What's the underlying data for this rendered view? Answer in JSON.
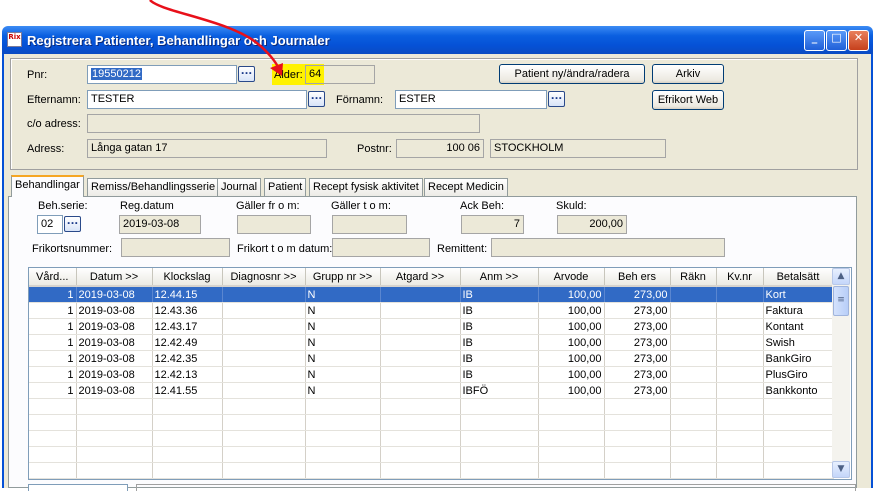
{
  "window": {
    "title": "Registrera Patienter, Behandlingar och Journaler",
    "icon_text": "Rix",
    "minimize": "_",
    "maximize": "□",
    "close": "✕"
  },
  "patient": {
    "pnr_label": "Pnr:",
    "pnr_value": "19550212",
    "alder_label": "Ålder:",
    "alder_value": "64",
    "efternamn_label": "Efternamn:",
    "efternamn_value": "TESTER",
    "fornamn_label": "Förnamn:",
    "fornamn_value": "ESTER",
    "co_label": "c/o adress:",
    "co_value": "",
    "adress_label": "Adress:",
    "adress_value": "Långa gatan 17",
    "postnr_label": "Postnr:",
    "postnr_value": "100 06",
    "ort_value": "STOCKHOLM",
    "btn_patient": "Patient ny/ändra/radera",
    "btn_arkiv": "Arkiv",
    "btn_efrikort": "Efrikort Web",
    "dots_label": "..."
  },
  "tabs": [
    "Behandlingar",
    "Remiss/Behandlingsserie",
    "Journal",
    "Patient",
    "Recept fysisk aktivitet",
    "Recept Medicin"
  ],
  "behandling": {
    "behserie_label": "Beh.serie:",
    "behserie_value": "02",
    "regdatum_label": "Reg.datum",
    "regdatum_value": "2019-03-08",
    "gallerfrom_label": "Gäller fr o m:",
    "gallerfrom_value": "",
    "gallertom_label": "Gäller t o m:",
    "gallertom_value": "",
    "ackbeh_label": "Ack Beh:",
    "ackbeh_value": "7",
    "skuld_label": "Skuld:",
    "skuld_value": "200,00",
    "frikort_label": "Frikortsnummer:",
    "frikort_value": "",
    "frikorttom_label": "Frikort t o m datum:",
    "frikorttom_value": "",
    "remittent_label": "Remittent:",
    "remittent_value": ""
  },
  "table": {
    "columns": [
      "Vård...",
      "Datum >>",
      "Klockslag",
      "Diagnosnr >>",
      "Grupp nr >>",
      "Atgard >>",
      "Anm >>",
      "Arvode",
      "Beh ers",
      "Räkn",
      "Kv.nr",
      "Betalsätt"
    ],
    "rows": [
      [
        "1",
        "2019-03-08",
        "12.44.15",
        "",
        "N",
        "",
        "IB",
        "100,00",
        "273,00",
        "",
        "",
        "Kort"
      ],
      [
        "1",
        "2019-03-08",
        "12.43.36",
        "",
        "N",
        "",
        "IB",
        "100,00",
        "273,00",
        "",
        "",
        "Faktura"
      ],
      [
        "1",
        "2019-03-08",
        "12.43.17",
        "",
        "N",
        "",
        "IB",
        "100,00",
        "273,00",
        "",
        "",
        "Kontant"
      ],
      [
        "1",
        "2019-03-08",
        "12.42.49",
        "",
        "N",
        "",
        "IB",
        "100,00",
        "273,00",
        "",
        "",
        "Swish"
      ],
      [
        "1",
        "2019-03-08",
        "12.42.35",
        "",
        "N",
        "",
        "IB",
        "100,00",
        "273,00",
        "",
        "",
        "BankGiro"
      ],
      [
        "1",
        "2019-03-08",
        "12.42.13",
        "",
        "N",
        "",
        "IB",
        "100,00",
        "273,00",
        "",
        "",
        "PlusGiro"
      ],
      [
        "1",
        "2019-03-08",
        "12.41.55",
        "",
        "N",
        "",
        "IBFÖ",
        "100,00",
        "273,00",
        "",
        "",
        "Bankkonto"
      ]
    ],
    "selected_row": 0,
    "scroll_up": "▲",
    "scroll_down": "▼",
    "thumb_grip": "≡"
  },
  "colors": {
    "titlebar": "#0551d6",
    "selection": "#316ac5",
    "highlight": "#fff200",
    "annotation_arrow": "#e8101a"
  }
}
